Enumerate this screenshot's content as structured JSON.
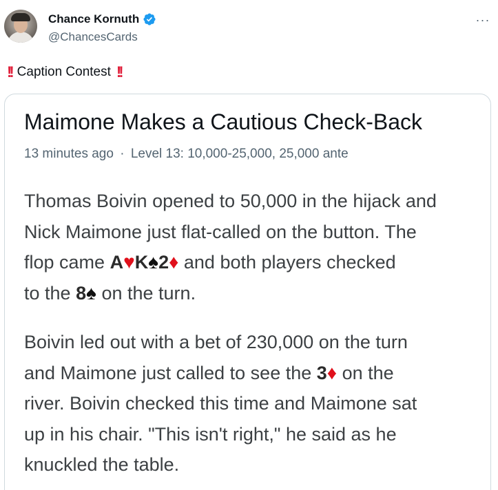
{
  "tweet": {
    "display_name": "Chance Kornuth",
    "handle": "@ChancesCards",
    "more_label": "···",
    "caption_bang": "!!",
    "caption_text": "Caption Contest"
  },
  "article": {
    "title": "Maimone Makes a Cautious Check-Back",
    "meta_time": "13 minutes ago",
    "meta_sep": "·",
    "meta_level": "Level 13: 10,000-25,000, 25,000 ante",
    "p1": {
      "line1": "Thomas Boivin opened to 50,000 in the hijack and",
      "line2": "Nick Maimone just flat-called on the button. The",
      "line3_pre": "flop came ",
      "line3_post": " and both players checked",
      "line4_pre": "to the ",
      "line4_post": " on the turn.",
      "cards": {
        "c1_rank": "A",
        "c1_suit": "♥",
        "c2_rank": "K",
        "c2_suit": "♠",
        "c3_rank": "2",
        "c3_suit": "♦",
        "c4_rank": "8",
        "c4_suit": "♠"
      }
    },
    "p2": {
      "line1": "Boivin led out with a bet of 230,000 on the turn",
      "line2_pre": "and Maimone just called to see the ",
      "line2_post": " on the",
      "line3": "river. Boivin checked this time and Maimone sat",
      "line4": "up in his chair. \"This isn't right,\" he said as he",
      "line5": "knuckled the table.",
      "cards": {
        "c5_rank": "3",
        "c5_suit": "♦"
      }
    }
  },
  "colors": {
    "verified": "#1d9bf0",
    "caption_bang": "#e0203b",
    "suit_red": "#e0101b",
    "suit_black": "#111111"
  }
}
